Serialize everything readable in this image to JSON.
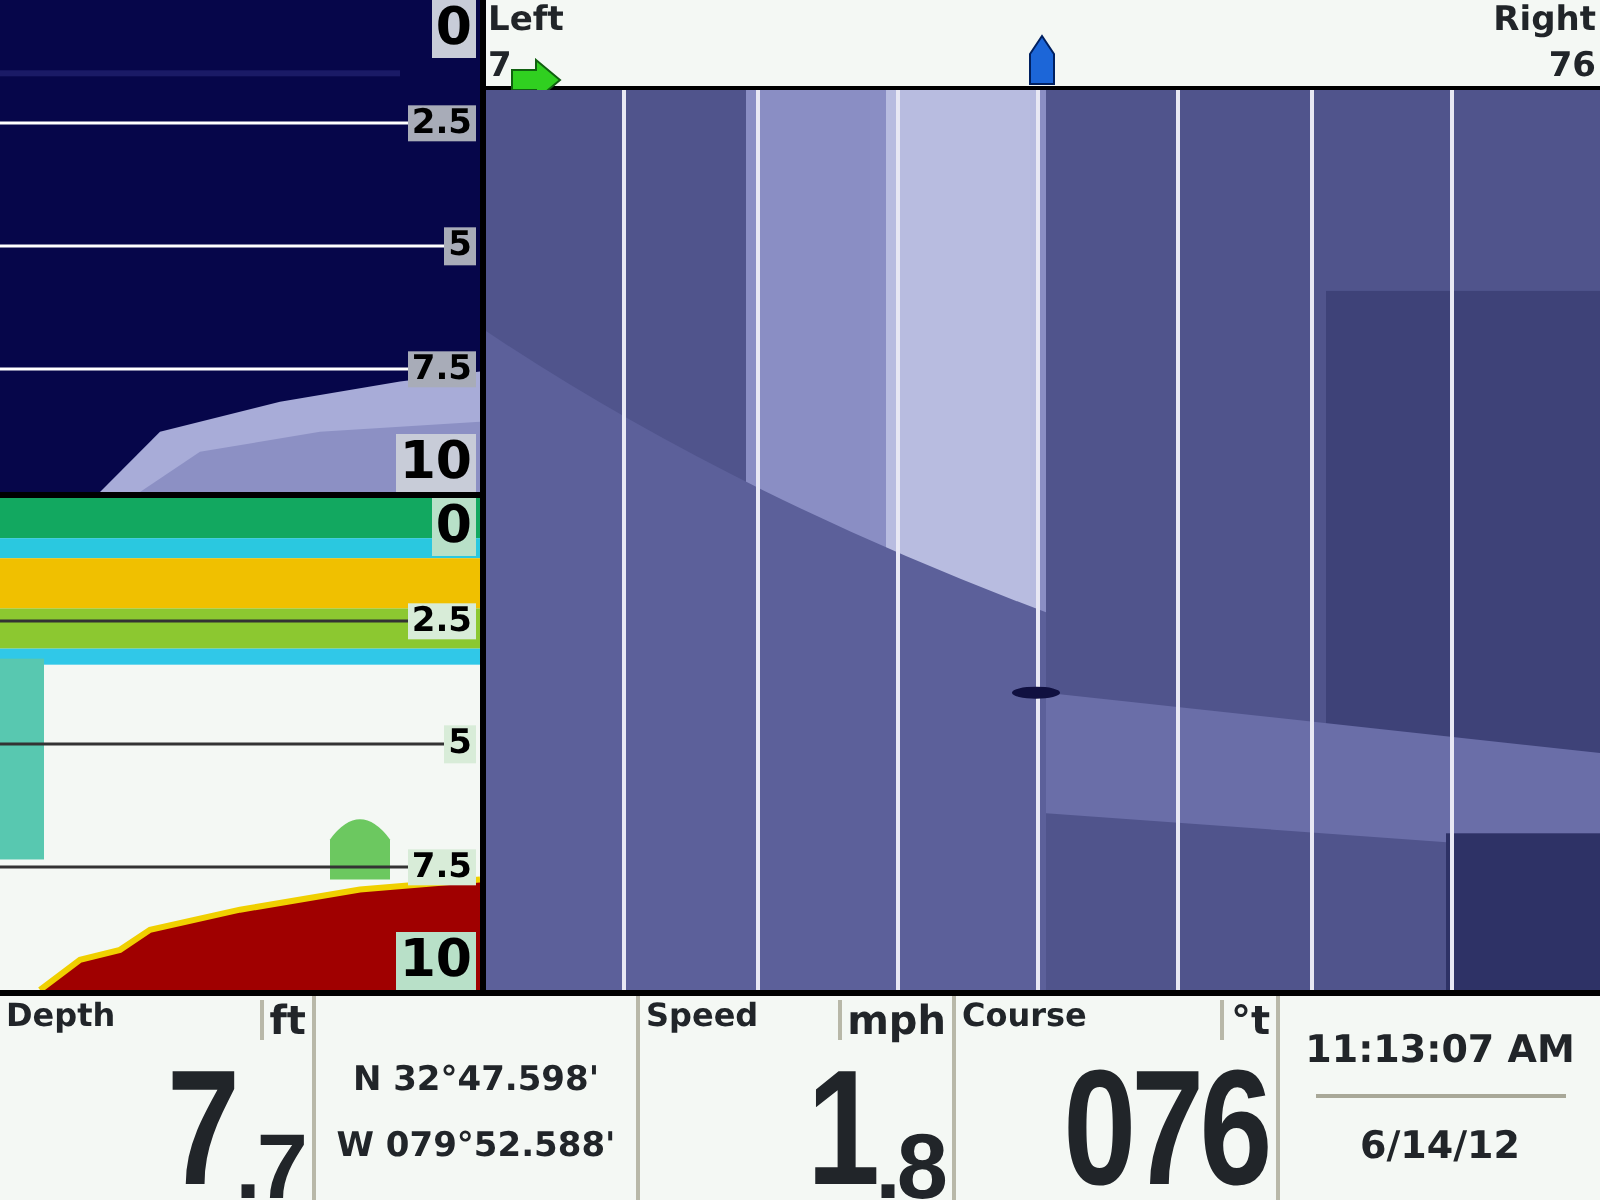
{
  "down_view": {
    "scale": [
      "0",
      "2.5",
      "5",
      "7.5",
      "10"
    ]
  },
  "sonar_view": {
    "scale": [
      "0",
      "2.5",
      "5",
      "7.5",
      "10"
    ]
  },
  "side_view": {
    "left_label": "Left",
    "right_label": "Right",
    "left_range": "7",
    "right_range": "76"
  },
  "readouts": [
    {
      "kind": "value",
      "label": "Depth",
      "unit": "ft",
      "whole": "7",
      "fraction": ".7"
    },
    {
      "kind": "position",
      "lines": [
        "N 32°47.598'",
        "W 079°52.588'"
      ]
    },
    {
      "kind": "value",
      "label": "Speed",
      "unit": "mph",
      "whole": "1",
      "fraction": ".8"
    },
    {
      "kind": "value",
      "label": "Course",
      "unit": "°t",
      "whole": "076"
    },
    {
      "kind": "clock",
      "time": "11:13:07 AM",
      "date": "6/14/12"
    }
  ]
}
